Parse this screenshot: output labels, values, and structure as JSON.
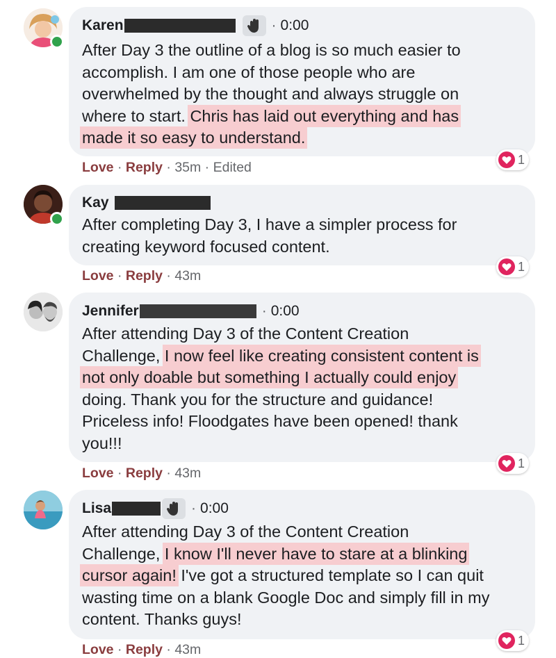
{
  "colors": {
    "bubble": "#f0f2f5",
    "highlight": "#f7cdd0",
    "love_action": "#8a3d3f",
    "online_dot": "#31a24c",
    "heart": "#e0245e"
  },
  "comments": [
    {
      "name": "Karen",
      "has_wave_icon": true,
      "voice_time": "0:00",
      "lines": [
        [
          "After Day 3 the outline of a blog is so much easier to"
        ],
        [
          "accomplish. I am one of those people who are"
        ],
        [
          "overwhelmed by the thought and always struggle on"
        ],
        [
          "where to start. ",
          "Chris has laid out everything and has"
        ],
        [
          "made it so easy to understand."
        ]
      ],
      "actions": {
        "love": "Love",
        "reply": "Reply",
        "time": "35m",
        "edited": "Edited"
      },
      "reaction_count": "1",
      "online": true
    },
    {
      "name": "Kay",
      "lines": [
        [
          "After completing Day 3, I have a simpler process for"
        ],
        [
          "creating keyword focused content."
        ]
      ],
      "actions": {
        "love": "Love",
        "reply": "Reply",
        "time": "43m"
      },
      "reaction_count": "1",
      "online": true
    },
    {
      "name": "Jennifer",
      "voice_time": "0:00",
      "lines": [
        [
          "After attending Day 3 of the Content Creation"
        ],
        [
          "Challenge, ",
          "I now feel like creating consistent content is"
        ],
        [
          "not only doable but something I actually could enjoy"
        ],
        [
          "doing. Thank you for the structure and guidance!"
        ],
        [
          "Priceless info! Floodgates have been opened! thank"
        ],
        [
          "you!!!"
        ]
      ],
      "actions": {
        "love": "Love",
        "reply": "Reply",
        "time": "43m"
      },
      "reaction_count": "1"
    },
    {
      "name": "Lisa",
      "has_wave_icon": true,
      "voice_time": "0:00",
      "lines": [
        [
          "After attending Day 3 of the Content Creation"
        ],
        [
          "Challenge, ",
          "I know I'll never have to stare at a blinking"
        ],
        [
          "cursor again!",
          " I've got a structured template so I can quit"
        ],
        [
          "wasting time on a blank Google Doc and simply fill in my"
        ],
        [
          "content. Thanks guys!"
        ]
      ],
      "actions": {
        "love": "Love",
        "reply": "Reply",
        "time": "43m"
      },
      "reaction_count": "1"
    }
  ]
}
